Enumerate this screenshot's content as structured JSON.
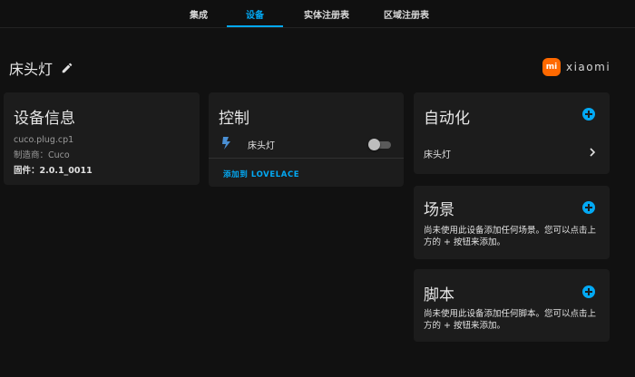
{
  "tabs": [
    {
      "label": "集成",
      "active": false
    },
    {
      "label": "设备",
      "active": true
    },
    {
      "label": "实体注册表",
      "active": false
    },
    {
      "label": "区域注册表",
      "active": false
    }
  ],
  "header": {
    "title": "床头灯",
    "brand_logo_text": "mi",
    "brand_name": "xiaomi"
  },
  "device_info": {
    "title": "设备信息",
    "model": "cuco.plug.cp1",
    "manufacturer": "制造商：Cuco",
    "firmware": "固件：2.0.1_0011"
  },
  "control": {
    "title": "控制",
    "entity_name": "床头灯",
    "toggle_on": false,
    "add_button": "添加到 LOVELACE"
  },
  "automation": {
    "title": "自动化",
    "items": [
      {
        "label": "床头灯"
      }
    ]
  },
  "scene": {
    "title": "场景",
    "description": "尚未使用此设备添加任何场景。您可以点击上方的 + 按钮来添加。"
  },
  "script": {
    "title": "脚本",
    "description": "尚未使用此设备添加任何脚本。您可以点击上方的 + 按钮来添加。"
  },
  "colors": {
    "accent": "#03a9f4",
    "background": "#111111",
    "card": "#1c1c1c",
    "brand": "#ff6900"
  }
}
